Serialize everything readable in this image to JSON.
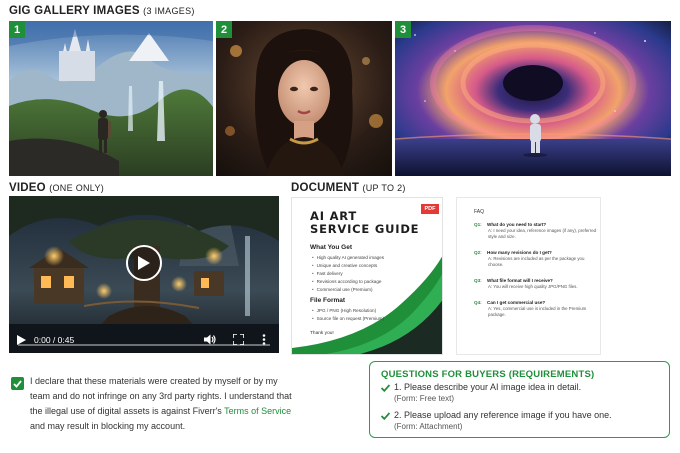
{
  "gallery": {
    "title": "GIG GALLERY IMAGES",
    "count_label": "(3 IMAGES)",
    "images": [
      {
        "badge": "1"
      },
      {
        "badge": "2"
      },
      {
        "badge": "3"
      }
    ]
  },
  "video": {
    "title": "VIDEO",
    "subtitle": "(ONE ONLY)",
    "time": "0:00 / 0:45",
    "progress": 0
  },
  "document": {
    "title": "DOCUMENT",
    "subtitle": "(UP TO 2)",
    "page1": {
      "pdf_badge": "PDF",
      "heading_line1": "AI ART",
      "heading_line2": "SERVICE GUIDE",
      "what_you_get": "What You Get",
      "items": [
        "High quality AI generated images",
        "Unique and creative concepts",
        "Fast delivery",
        "Revisions according to package",
        "Commercial use (Premium)"
      ],
      "file_format": "File Format",
      "formats": [
        "JPG / PNG (High Resolution)",
        "Source file on request (Premium)"
      ],
      "thanks": "Thank you!"
    },
    "page2": {
      "heading": "FAQ",
      "faqs": [
        {
          "n": "Q1:",
          "q": "What do you need to start?",
          "a": "A: I need your idea, reference images (if any), preferred style and size."
        },
        {
          "n": "Q2:",
          "q": "How many revisions do I get?",
          "a": "A: Revisions are included as per the package you choose."
        },
        {
          "n": "Q3:",
          "q": "What file format will I receive?",
          "a": "A: You will receive high quality JPG/PNG files."
        },
        {
          "n": "Q4:",
          "q": "Can I get commercial use?",
          "a": "A: Yes, commercial use is included in the Premium package."
        }
      ]
    }
  },
  "declaration": {
    "checked": true,
    "text_before": "I declare that these materials were created by myself or by my team and do not infringe on any 3rd party rights. I understand that the illegal use of digital assets is against Fiverr's ",
    "link": "Terms of Service",
    "text_after": " and may result in blocking my account."
  },
  "questions": {
    "title": "QUESTIONS FOR BUYERS (REQUIREMENTS)",
    "items": [
      {
        "text": "1. Please describe your AI image idea in detail.",
        "form": "(Form: Free text)"
      },
      {
        "text": "2. Please upload any reference image if you have one.",
        "form": "(Form: Attachment)"
      }
    ]
  },
  "colors": {
    "accent": "#1f8f3a",
    "badge_bg": "#1f8f3a",
    "pdf_red": "#e53935"
  },
  "icons": [
    "play-icon",
    "volume-icon",
    "fullscreen-icon",
    "more-options-icon",
    "check-icon",
    "checkbox-icon"
  ]
}
